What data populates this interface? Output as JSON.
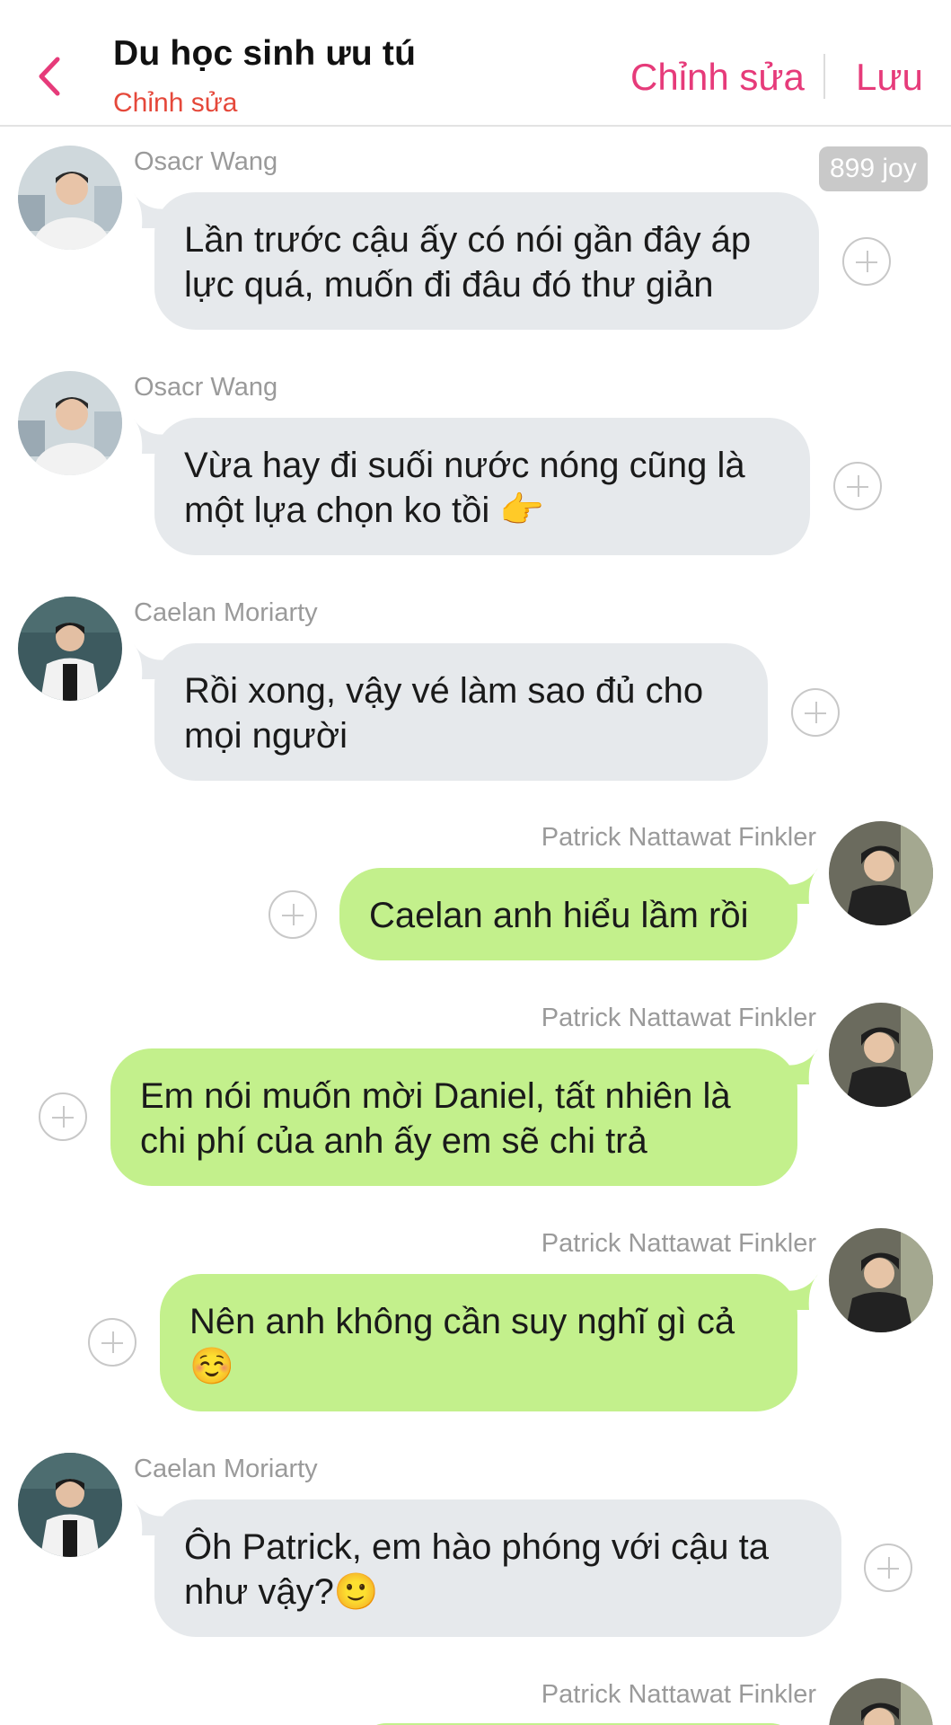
{
  "header": {
    "title": "Du học sinh ưu tú",
    "subtitle": "Chỉnh sửa",
    "edit_label": "Chỉnh sửa",
    "save_label": "Lưu"
  },
  "joy_badge": "899 joy",
  "messages": [
    {
      "sender": "Osacr Wang",
      "lines": [
        "Lần trước cậu ấy có nói gần đây áp",
        "lực quá, muốn đi đâu đó thư giản"
      ],
      "side": "left"
    },
    {
      "sender": "Osacr Wang",
      "lines": [
        "Vừa hay đi suối nước nóng cũng là",
        "một lựa chọn ko tồi 👉"
      ],
      "side": "left"
    },
    {
      "sender": "Caelan Moriarty",
      "lines": [
        "Rồi xong, vậy vé làm sao đủ cho",
        "mọi người"
      ],
      "side": "left"
    },
    {
      "sender": "Patrick Nattawat Finkler",
      "lines": [
        "Caelan anh hiểu lầm rồi"
      ],
      "side": "right"
    },
    {
      "sender": "Patrick Nattawat Finkler",
      "lines": [
        "Em nói muốn mời Daniel, tất nhiên là",
        "chi phí của anh ấy em sẽ chi trả"
      ],
      "side": "right"
    },
    {
      "sender": "Patrick Nattawat Finkler",
      "lines": [
        "Nên anh không cần suy nghĩ gì cả",
        "☺️"
      ],
      "side": "right"
    },
    {
      "sender": "Caelan Moriarty",
      "lines": [
        "Ôh Patrick, em hào phóng với cậu ta",
        "như vậy?🙂"
      ],
      "side": "left"
    },
    {
      "sender": "Patrick Nattawat Finkler",
      "lines": [],
      "side": "right"
    }
  ],
  "colors": {
    "accent": "#e63b7a",
    "subtitle": "#e5483a",
    "bubble_left": "#e6e9ec",
    "bubble_right": "#c3f08c"
  }
}
